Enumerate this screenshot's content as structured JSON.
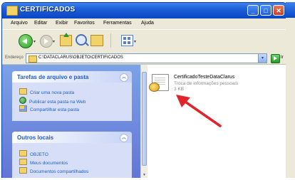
{
  "window": {
    "title": "CERTIFICADOS"
  },
  "menu": [
    "Arquivo",
    "Editar",
    "Exibir",
    "Favoritos",
    "Ferramentas",
    "Ajuda"
  ],
  "toolbar": {
    "icons": [
      "back-icon",
      "forward-icon",
      "up-folder-icon",
      "search-icon",
      "folders-icon",
      "views-icon"
    ]
  },
  "address": {
    "label": "Endereço",
    "path": "C:\\DATACLARUS\\OBJETO\\CERTIFICADOS",
    "go_label": "Ir"
  },
  "tasks": {
    "title": "Tarefas de arquivo e pasta",
    "items": [
      "Criar uma nova pasta",
      "Publicar esta pasta na Web",
      "Compartilhar esta pasta"
    ]
  },
  "places": {
    "title": "Outros locais",
    "items": [
      "OBJETO",
      "Meus documentos",
      "Documentos compartilhados"
    ]
  },
  "file": {
    "name": "CertificadoTesteDataClarus",
    "type": "Troca de informações pessoais",
    "size": "3 KB",
    "icon": "certificate-file-icon"
  },
  "colors": {
    "annotation_arrow": "#e0242b",
    "titlebar": "#0b46c4",
    "taskpane_link": "#215dc6"
  }
}
